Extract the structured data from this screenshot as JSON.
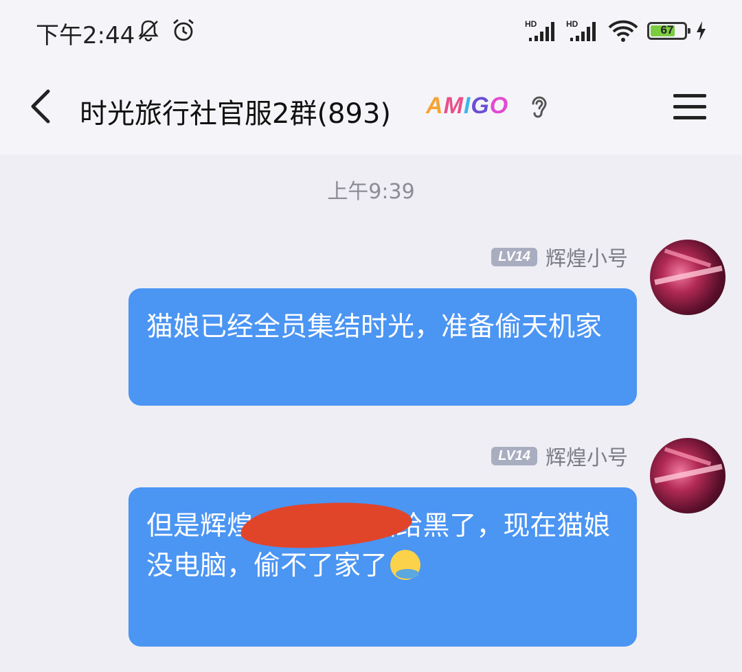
{
  "status_bar": {
    "time": "下午2:44",
    "hd1": "HD",
    "hd2": "HD",
    "battery_level": "67",
    "icons_left": [
      "mute-bell-icon",
      "alarm-clock-icon"
    ],
    "icons_right": [
      "hd-signal-icon",
      "hd-signal-icon",
      "wifi-icon",
      "battery-icon",
      "charging-bolt-icon"
    ]
  },
  "header": {
    "title": "时光旅行社官服2群(893)",
    "badge": "AMIGO",
    "icons": [
      "back-chevron-icon",
      "ear-icon",
      "menu-icon"
    ]
  },
  "chat": {
    "timestamp": "上午9:39",
    "messages": [
      {
        "level": "LV14",
        "sender": "辉煌小号",
        "text": "猫娘已经全员集结时光，准备偷天机家"
      },
      {
        "level": "LV14",
        "sender": "辉煌小号",
        "text": "但是辉煌 把猫娘电脑给黑了，现在猫娘没电脑，偷不了家了",
        "emoji": "fish-mouth-emoji"
      }
    ]
  },
  "colors": {
    "bubble": "#4b95f3",
    "background": "#eeeef4",
    "level_badge": "#a9adc0",
    "redaction": "#e0452a"
  }
}
